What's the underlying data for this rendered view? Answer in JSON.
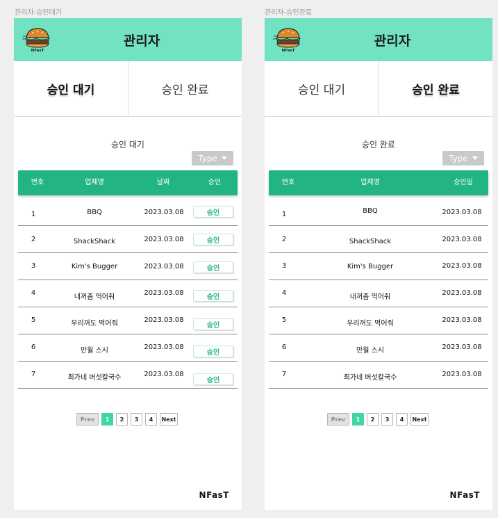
{
  "frames": [
    {
      "label": "관리자-승인대기",
      "header_title": "관리자",
      "logo_text": "NFasT",
      "tabs": [
        {
          "label": "승인 대기",
          "active": true
        },
        {
          "label": "승인 완료",
          "active": false
        }
      ],
      "section_title": "승인 대기",
      "type_button": "Type",
      "columns": [
        "번호",
        "업체명",
        "날짜",
        "승인"
      ],
      "rows": [
        {
          "num": "1",
          "name": "BBQ",
          "date": "2023.03.08",
          "action": "승인"
        },
        {
          "num": "2",
          "name": "ShackShack",
          "date": "2023.03.08",
          "action": "승인"
        },
        {
          "num": "3",
          "name": "Kim's Bugger",
          "date": "2023.03.08",
          "action": "승인"
        },
        {
          "num": "4",
          "name": "내꺼좀 먹어줘",
          "date": "2023.03.08",
          "action": "승인"
        },
        {
          "num": "5",
          "name": "우리꺼도 먹어줘",
          "date": "2023.03.08",
          "action": "승인"
        },
        {
          "num": "6",
          "name": "만월 스시",
          "date": "2023.03.08",
          "action": "승인"
        },
        {
          "num": "7",
          "name": "최가네 버섯칼국수",
          "date": "2023.03.08",
          "action": "승인"
        }
      ],
      "pagination": {
        "prev": "Prev",
        "pages": [
          "1",
          "2",
          "3",
          "4"
        ],
        "current": "1",
        "next": "Next"
      },
      "brand": "NFasT"
    },
    {
      "label": "관리자-승인완료",
      "header_title": "관리자",
      "logo_text": "NFasT",
      "tabs": [
        {
          "label": "승인 대기",
          "active": false
        },
        {
          "label": "승인 완료",
          "active": true
        }
      ],
      "section_title": "승인 완료",
      "type_button": "Type",
      "columns": [
        "번호",
        "업체명",
        "승인일"
      ],
      "rows": [
        {
          "num": "1",
          "name": "BBQ",
          "date": "2023.03.08"
        },
        {
          "num": "2",
          "name": "ShackShack",
          "date": "2023.03.08"
        },
        {
          "num": "3",
          "name": "Kim's Bugger",
          "date": "2023.03.08"
        },
        {
          "num": "4",
          "name": "내꺼좀 먹어줘",
          "date": "2023.03.08"
        },
        {
          "num": "5",
          "name": "우리꺼도 먹어줘",
          "date": "2023.03.08"
        },
        {
          "num": "6",
          "name": "만월 스시",
          "date": "2023.03.08"
        },
        {
          "num": "7",
          "name": "최가네 버섯칼국수",
          "date": "2023.03.08"
        }
      ],
      "pagination": {
        "prev": "Prev",
        "pages": [
          "1",
          "2",
          "3",
          "4"
        ],
        "current": "1",
        "next": "Next"
      },
      "brand": "NFasT"
    }
  ],
  "colors": {
    "header": "#72e3c2",
    "table_header": "#22b482",
    "approve_text": "#22b482",
    "page_active": "#3fd6a5",
    "canvas": "#efefef"
  },
  "icons": {
    "logo": "burger-logo-icon",
    "type_caret": "caret-down-icon"
  }
}
